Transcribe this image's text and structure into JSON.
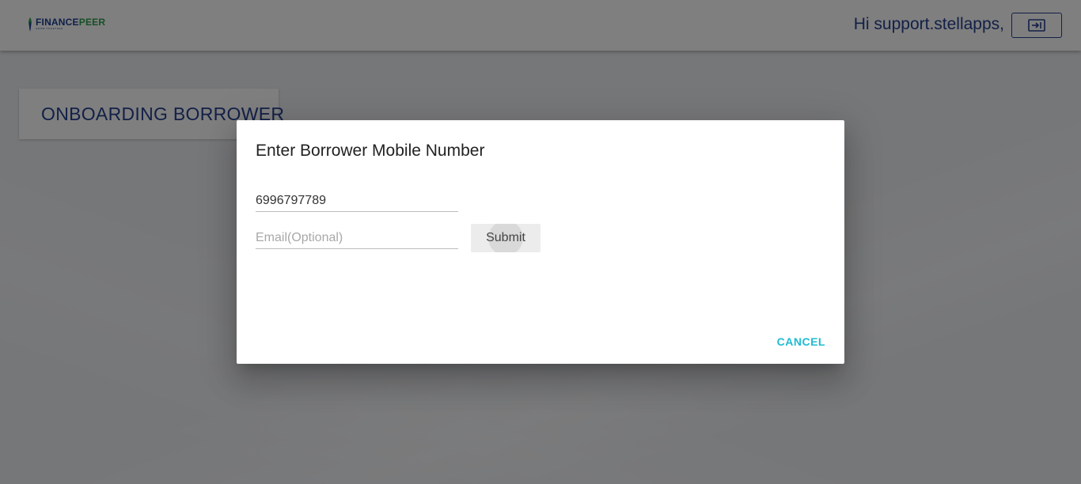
{
  "header": {
    "logo": {
      "text_primary": "FINANCE",
      "text_secondary": "PEER",
      "tagline": "GROW TOGETHER"
    },
    "greeting": "Hi support.stellapps,",
    "logout_icon": "exit-icon"
  },
  "main": {
    "card_title": "ONBOARDING BORROWER"
  },
  "dialog": {
    "title": "Enter Borrower Mobile Number",
    "mobile_value": "6996797789",
    "email_placeholder": "Email(Optional)",
    "submit_label": "Submit",
    "cancel_label": "CANCEL"
  },
  "colors": {
    "brand_blue": "#26418f",
    "brand_green": "#2f9e4f",
    "accent_cyan": "#1fbcd3"
  }
}
